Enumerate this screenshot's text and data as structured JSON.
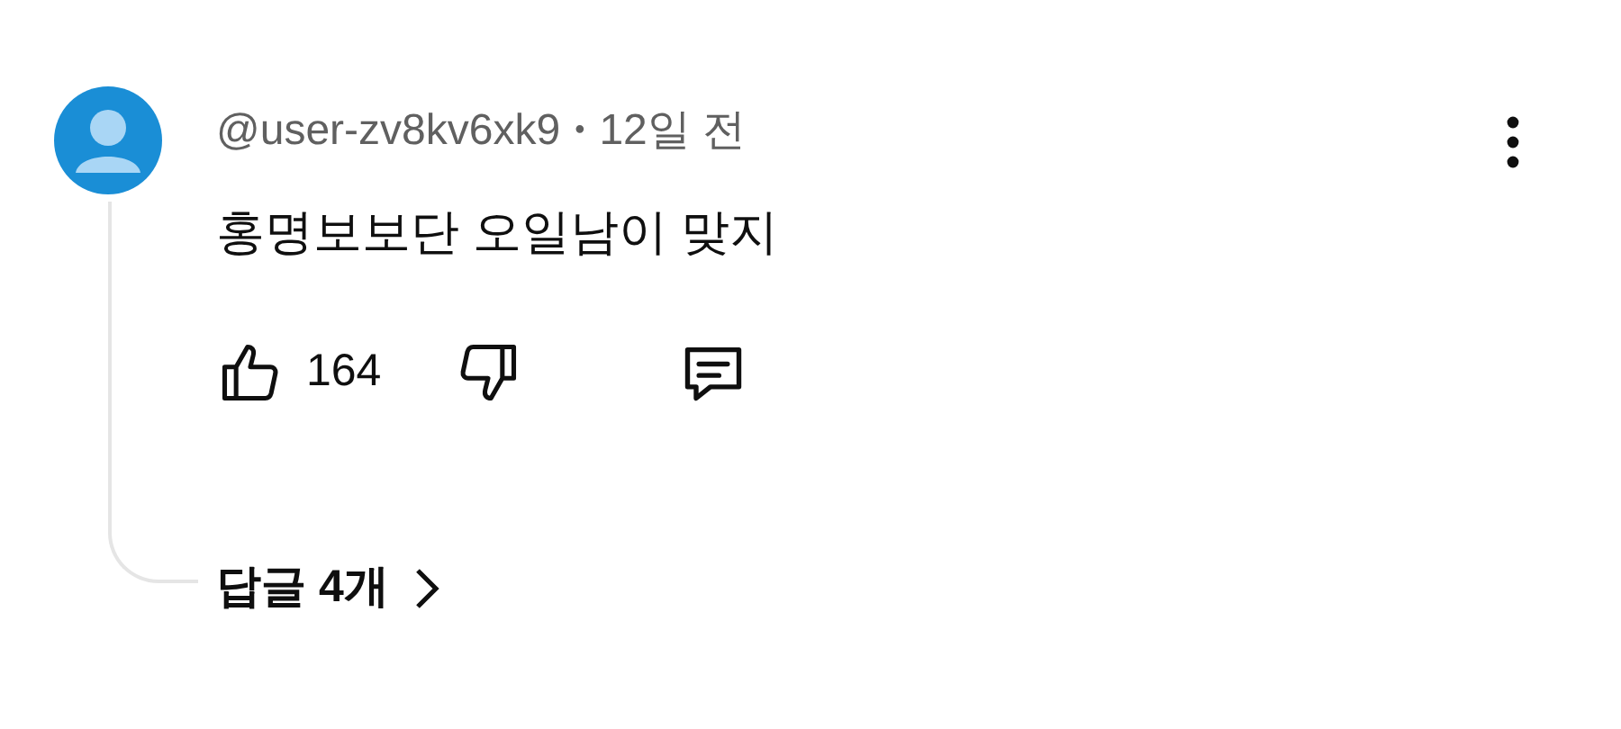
{
  "comment": {
    "author": "@user-zv8kv6xk9",
    "separator": "•",
    "time": "12일 전",
    "text": "홍명보보단 오일남이 맞지",
    "likes": "164",
    "replies": "답글 4개"
  }
}
